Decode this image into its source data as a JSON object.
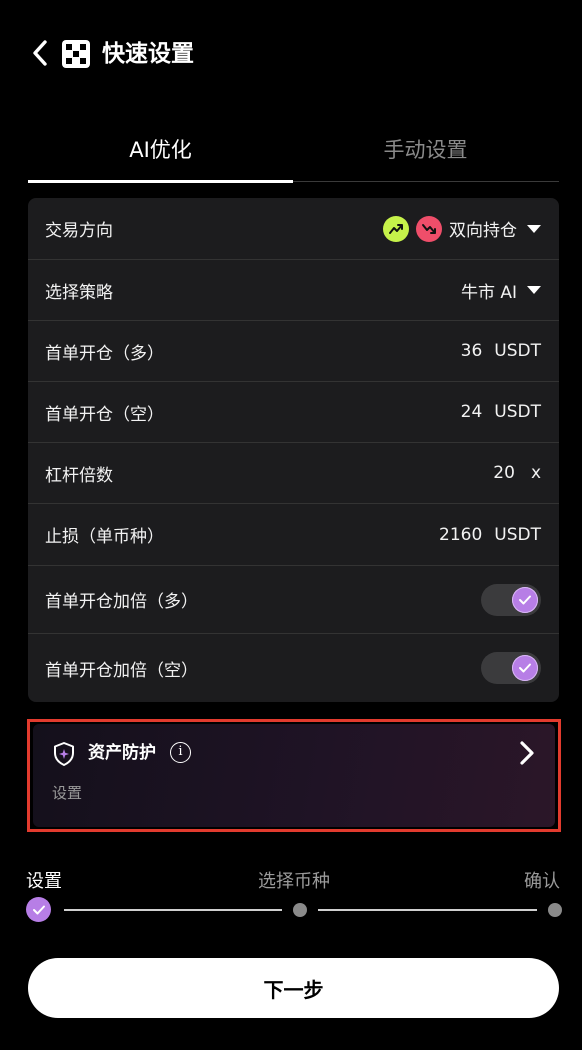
{
  "header": {
    "title": "快速设置",
    "back_icon": "chevron-left-icon",
    "logo_icon": "app-logo-icon"
  },
  "tabs": [
    {
      "label": "AI优化",
      "active": true
    },
    {
      "label": "手动设置",
      "active": false
    }
  ],
  "settings": {
    "direction": {
      "label": "交易方向",
      "value": "双向持仓",
      "icons": [
        "trend-up-icon",
        "trend-down-icon"
      ]
    },
    "strategy": {
      "label": "选择策略",
      "value": "牛市 AI"
    },
    "first_long": {
      "label": "首单开仓（多）",
      "amount": "36",
      "unit": "USDT"
    },
    "first_short": {
      "label": "首单开仓（空）",
      "amount": "24",
      "unit": "USDT"
    },
    "leverage": {
      "label": "杠杆倍数",
      "amount": "20",
      "unit": "x"
    },
    "stop_loss": {
      "label": "止损（单币种）",
      "amount": "2160",
      "unit": "USDT"
    },
    "double_long": {
      "label": "首单开仓加倍（多）",
      "enabled": true
    },
    "double_short": {
      "label": "首单开仓加倍（空）",
      "enabled": true
    }
  },
  "asset_protection": {
    "title": "资产防护",
    "subtitle": "设置",
    "info_icon": "info-icon",
    "shield_icon": "shield-icon"
  },
  "steps": [
    {
      "label": "设置",
      "state": "done"
    },
    {
      "label": "选择币种",
      "state": "pending"
    },
    {
      "label": "确认",
      "state": "pending"
    }
  ],
  "next_button": {
    "label": "下一步"
  },
  "colors": {
    "accent_purple": "#b77ee6",
    "up_green": "#c6f24a",
    "down_red": "#ef4e6a",
    "highlight_red": "#e23b2e",
    "card_bg": "#1c1c1e"
  }
}
